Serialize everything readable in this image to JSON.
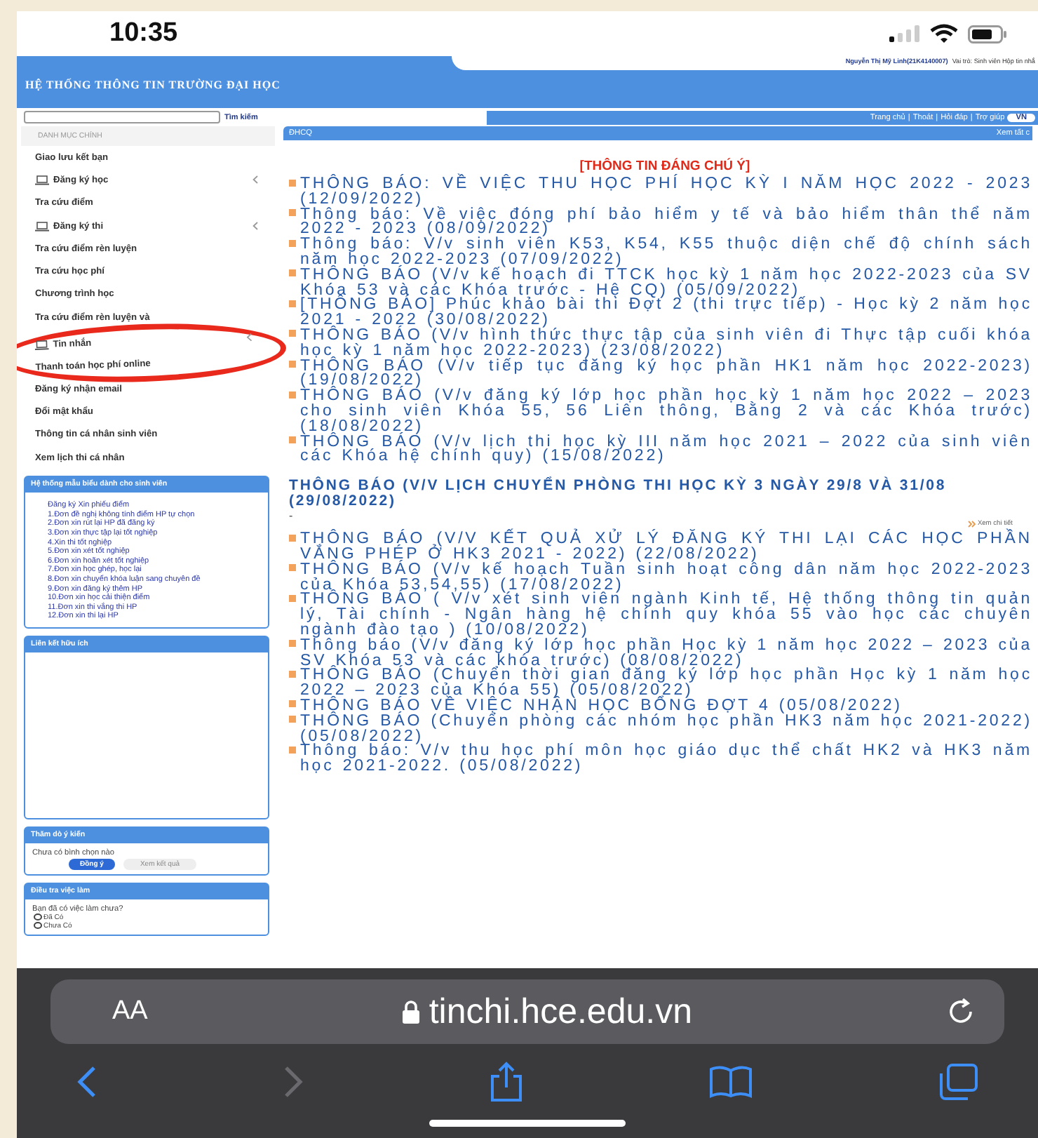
{
  "status_bar": {
    "time": "10:35"
  },
  "header": {
    "title": "HỆ THỐNG THÔNG TIN TRƯỜNG ĐẠI HỌC",
    "user_name": "Nguyễn Thị Mỹ Linh(21K4140007)",
    "user_info": "Vai trò: Sinh viên Hộp tin nhắ"
  },
  "search": {
    "button": "Tìm kiếm"
  },
  "nav": {
    "links": [
      "Trang chủ",
      "Thoát",
      "Hỏi đáp",
      "Trợ giúp"
    ],
    "separator": "|",
    "language": {
      "label": "VN",
      "selected": true
    }
  },
  "sidebar": {
    "title": "DANH MỤC CHÍNH",
    "items": [
      {
        "label": "Giao lưu kết bạn",
        "kind": "link",
        "circled": false
      },
      {
        "label": "Đăng ký học",
        "kind": "group",
        "circled": false
      },
      {
        "label": "Tra cứu điểm",
        "kind": "link",
        "circled": false
      },
      {
        "label": "Đăng ký thi",
        "kind": "group",
        "circled": false
      },
      {
        "label": "Tra cứu điểm rèn luyện",
        "kind": "link",
        "circled": false
      },
      {
        "label": "Tra cứu học phí",
        "kind": "link",
        "circled": false
      },
      {
        "label": "Chương trình học",
        "kind": "link",
        "circled": false
      },
      {
        "label": "Tra cứu điểm rèn luyện và",
        "kind": "link",
        "circled": false
      },
      {
        "label": "Tin nhắn",
        "kind": "group",
        "circled": true
      },
      {
        "label": "Thanh toán học phí online",
        "kind": "link",
        "circled": true
      },
      {
        "label": "Đăng ký nhận email",
        "kind": "link",
        "circled": false
      },
      {
        "label": "Đổi mật khẩu",
        "kind": "link",
        "circled": false
      },
      {
        "label": "Thông tin cá nhân sinh viên",
        "kind": "link",
        "circled": false
      },
      {
        "label": "Xem lịch thi cá nhân",
        "kind": "link",
        "circled": false
      }
    ],
    "forms_panel": {
      "title": "Hệ thống mẫu biểu dành cho sinh viên",
      "links": [
        "Đăng ký Xin phiếu điểm",
        "1.Đơn đề nghị không tính điểm HP tự chọn",
        "2.Đơn xin rút lại HP đã đăng ký",
        "3.Đơn xin thực tập lại tốt nghiệp",
        "4.Xin thi tốt nghiệp",
        "5.Đơn xin xét tốt nghiệp",
        "6.Đơn xin hoãn xét tốt nghiệp",
        "7.Đơn xin học ghép, học lại",
        "8.Đơn xin chuyển khóa luận sang chuyên đề",
        "9.Đơn xin đăng ký thêm HP",
        "10.Đơn xin học cải thiện điểm",
        "11.Đơn xin thi vắng thi HP",
        "12.Đơn xin thi lại HP"
      ]
    },
    "links_panel": {
      "title": "Liên kết hữu ích"
    },
    "poll_panel": {
      "title": "Thăm dò ý kiến",
      "text": "Chưa có bình chọn nào",
      "buttons": [
        {
          "label": "Đồng ý",
          "kind": "primary"
        },
        {
          "label": "Xem kết quả",
          "kind": "secondary"
        }
      ]
    },
    "survey_panel": {
      "title": "Điều tra việc làm",
      "question": "Bạn đã có việc làm chưa?",
      "options": [
        {
          "label": "Đã Có",
          "selected": false
        },
        {
          "label": "Chưa Có",
          "selected": false
        }
      ]
    }
  },
  "main": {
    "tab": "ĐHCQ",
    "view_all": "Xem tất c",
    "notice_title": "[THÔNG TIN ĐÁNG CHÚ Ý]",
    "notices": [
      "THÔNG BÁO: VỀ VIỆC THU HỌC PHÍ HỌC KỲ I NĂM HỌC 2022 - 2023 (12/09/2022)",
      "Thông báo: Về việc đóng phí bảo hiểm y tế và bảo hiểm thân thể năm 2022 - 2023 (08/09/2022)",
      "Thông báo: V/v sinh viên K53, K54, K55 thuộc diện chế độ chính sách năm học 2022-2023 (07/09/2022)",
      "THÔNG BÁO (V/v kế hoạch đi TTCK học kỳ 1 năm học 2022-2023 của SV Khóa 53 và các Khóa trước - Hệ CQ) (05/09/2022)",
      "[THÔNG BÁO] Phúc khảo bài thi Đợt 2 (thi trực tiếp) - Học kỳ 2 năm học 2021 - 2022 (30/08/2022)",
      "THÔNG BÁO (V/v hình thức thực tập của sinh viên đi Thực tập cuối khóa học kỳ 1 năm học 2022-2023) (23/08/2022)",
      "THÔNG BÁO (V/v tiếp tục đăng ký học phần HK1 năm học 2022-2023) (19/08/2022)",
      "THÔNG BÁO (V/v đăng ký lớp học phần học kỳ 1 năm học 2022 – 2023 cho sinh viên Khóa 55, 56 Liên thông, Bằng 2 và các Khóa trước) (18/08/2022)",
      "THÔNG BÁO (V/v lịch thi học kỳ III năm học 2021 – 2022 của sinh viên các Khóa hệ chính quy) (15/08/2022)"
    ],
    "featured_title": "THÔNG BÁO (V/V LỊCH CHUYỂN PHÒNG THI HỌC KỲ 3 NGÀY 29/8 VÀ 31/08 (29/08/2022)",
    "featured_excerpt": "-",
    "details_link": "Xem chi tiết",
    "news": [
      "THÔNG BÁO (V/V KẾT QUẢ XỬ LÝ ĐĂNG KÝ THI LẠI CÁC HỌC PHẦN VẮNG PHÉP Ở HK3 2021 - 2022) (22/08/2022)",
      "THÔNG BÁO (V/v kế hoạch Tuần sinh hoạt công dân năm học 2022-2023 của Khóa 53,54,55) (17/08/2022)",
      "THÔNG BÁO ( V/v xét sinh viên ngành Kinh tế, Hệ thống thông tin quản lý, Tài chính - Ngân hàng hệ chính quy khóa 55 vào học các chuyên ngành đào tạo ) (10/08/2022)",
      "Thông báo (V/v đăng ký lớp học phần Học kỳ 1 năm học 2022 – 2023 của SV Khóa 53 và các khóa trước) (08/08/2022)",
      "THÔNG BÁO (Chuyển thời gian đăng ký lớp học phần Học kỳ 1 năm học 2022 – 2023 của Khóa 55) (05/08/2022)",
      "THÔNG BÁO VỀ VIỆC NHẬN HỌC BỔNG ĐỢT 4 (05/08/2022)",
      "THÔNG BÁO (Chuyển phòng các nhóm học phần HK3 năm học 2021-2022) (05/08/2022)",
      "Thông báo: V/v thu học phí môn học giáo dục thể chất HK2 và HK3 năm học 2021-2022. (05/08/2022)"
    ]
  },
  "browser": {
    "text_size": "AA",
    "url": "tinchi.hce.edu.vn",
    "forward_disabled": true
  }
}
